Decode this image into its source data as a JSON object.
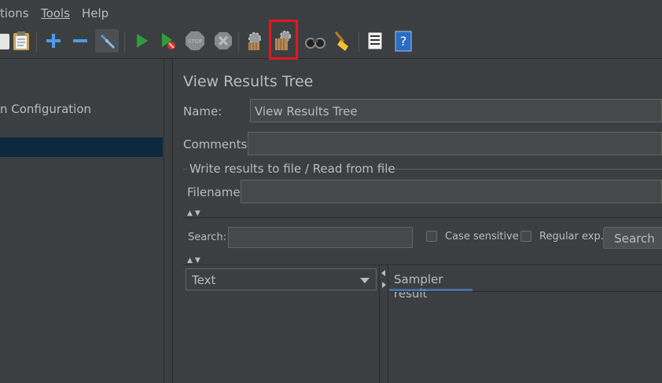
{
  "menu": {
    "items": [
      "tions",
      "Tools",
      "Help"
    ]
  },
  "toolbar": {
    "icons": [
      "clipboard-icon",
      "paste-icon",
      "add-icon",
      "remove-icon",
      "toggle-icon",
      "start-icon",
      "start-no-pauses-icon",
      "stop-icon",
      "shutdown-icon",
      "clear-icon",
      "clear-all-icon",
      "search-icon",
      "reset-search-icon",
      "function-helper-icon",
      "help-icon"
    ],
    "highlight_color": "#e8151b"
  },
  "tree": {
    "item_label": "n Configuration"
  },
  "panel": {
    "title": "View Results Tree",
    "name_label": "Name:",
    "name_value": "View Results Tree",
    "comments_label": "Comments:",
    "comments_value": "",
    "file_section_label": "Write results to file / Read from file",
    "filename_label": "Filename"
  },
  "search": {
    "label": "Search:",
    "value": "",
    "case_sensitive_label": "Case sensitive",
    "regular_exp_label": "Regular exp.",
    "button_label": "Search"
  },
  "results": {
    "renderer_value": "Text",
    "tab_label": "Sampler result"
  }
}
